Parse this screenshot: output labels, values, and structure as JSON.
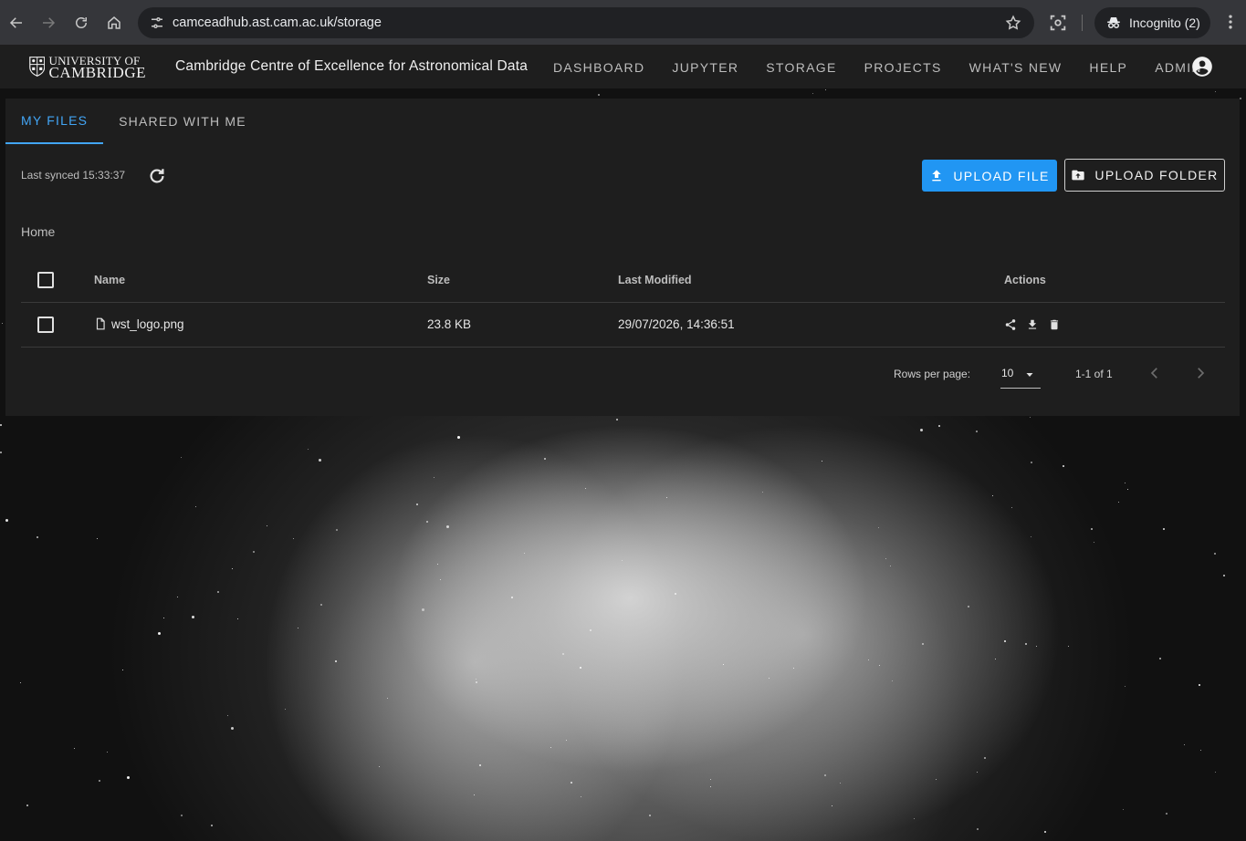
{
  "browser": {
    "url": "camceadhub.ast.cam.ac.uk/storage",
    "incognito_label": "Incognito (2)"
  },
  "header": {
    "logo_line1": "UNIVERSITY OF",
    "logo_line2": "CAMBRIDGE",
    "site_title": "Cambridge Centre of Excellence for Astronomical Data",
    "nav": [
      "DASHBOARD",
      "JUPYTER",
      "STORAGE",
      "PROJECTS",
      "WHAT'S NEW",
      "HELP",
      "ADMIN"
    ]
  },
  "storage": {
    "tabs": [
      "MY FILES",
      "SHARED WITH ME"
    ],
    "last_synced": "Last synced 15:33:37",
    "upload_file_label": "UPLOAD FILE",
    "upload_folder_label": "UPLOAD FOLDER",
    "breadcrumb": "Home",
    "columns": [
      "Name",
      "Size",
      "Last Modified",
      "Actions"
    ],
    "rows": [
      {
        "name": "wst_logo.png",
        "size": "23.8 KB",
        "modified": "29/07/2026, 14:36:51"
      }
    ],
    "rows_per_page_label": "Rows per page:",
    "rows_per_page_value": "10",
    "range_text": "1-1 of 1"
  },
  "colors": {
    "accent": "#42a5f5",
    "button_primary": "#2196f3",
    "panel_bg": "#1e1e1e"
  }
}
